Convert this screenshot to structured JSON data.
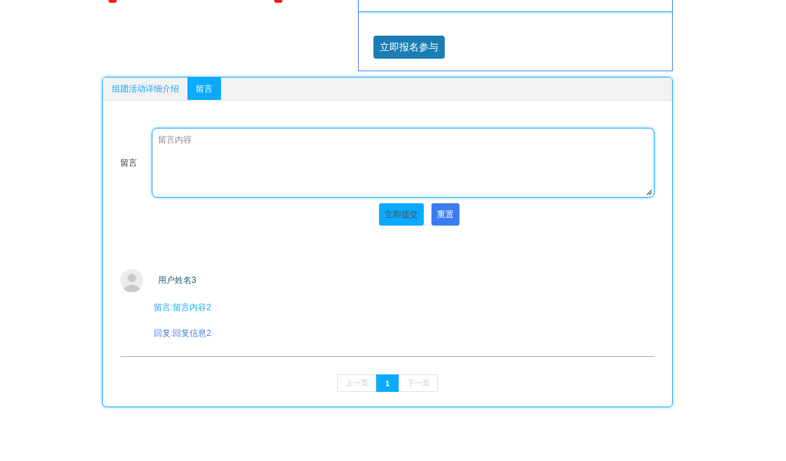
{
  "signup_panel": {
    "button": "立即报名参与"
  },
  "tabs": [
    {
      "label": "组团活动详细介绍",
      "selected": false
    },
    {
      "label": "留言",
      "selected": true
    }
  ],
  "message_form": {
    "label": "留言",
    "placeholder": "留言内容",
    "buttons": [
      {
        "label": "立即提交",
        "kind": "submit"
      },
      {
        "label": "重置",
        "kind": "reset"
      }
    ]
  },
  "comments": [
    {
      "user": "用户姓名3",
      "message": "留言:留言内容2",
      "reply": "回复:回复信息2"
    }
  ],
  "pagination": {
    "prev": {
      "label": "上一页",
      "disabled": true
    },
    "pages": [
      {
        "label": "1",
        "selected": true
      }
    ],
    "next": {
      "label": "下一页",
      "disabled": true
    }
  }
}
